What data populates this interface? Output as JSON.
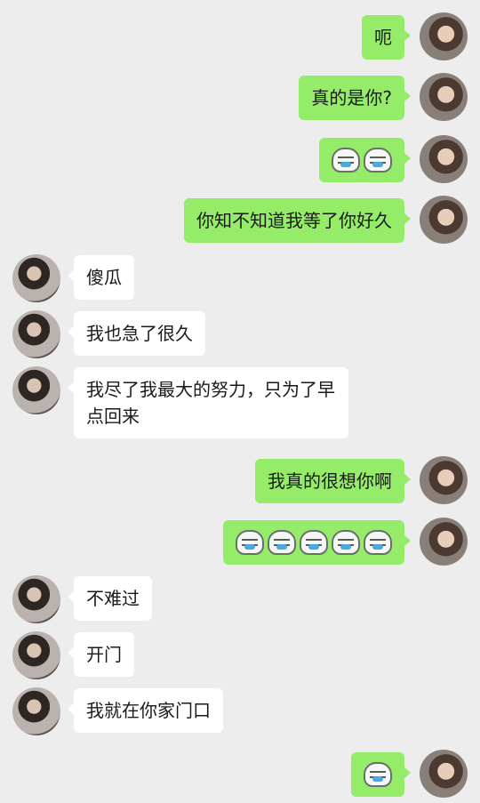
{
  "messages": [
    {
      "side": "sent",
      "text": "呃"
    },
    {
      "side": "sent",
      "text": "真的是你?"
    },
    {
      "side": "sent",
      "emoji_name": "crying-emoji",
      "emoji_count": 2
    },
    {
      "side": "sent",
      "text": "你知不知道我等了你好久"
    },
    {
      "side": "recv",
      "text": "傻瓜"
    },
    {
      "side": "recv",
      "text": "我也急了很久"
    },
    {
      "side": "recv",
      "text": "我尽了我最大的努力，只为了早点回来"
    },
    {
      "side": "sent",
      "text": "我真的很想你啊"
    },
    {
      "side": "sent",
      "emoji_name": "crying-emoji",
      "emoji_count": 5
    },
    {
      "side": "recv",
      "text": "不难过"
    },
    {
      "side": "recv",
      "text": "开门"
    },
    {
      "side": "recv",
      "text": "我就在你家门口"
    },
    {
      "side": "sent",
      "emoji_name": "crying-emoji",
      "emoji_count": 1
    }
  ],
  "colors": {
    "background": "#ededed",
    "sent_bubble": "#95ec69",
    "recv_bubble": "#ffffff"
  }
}
